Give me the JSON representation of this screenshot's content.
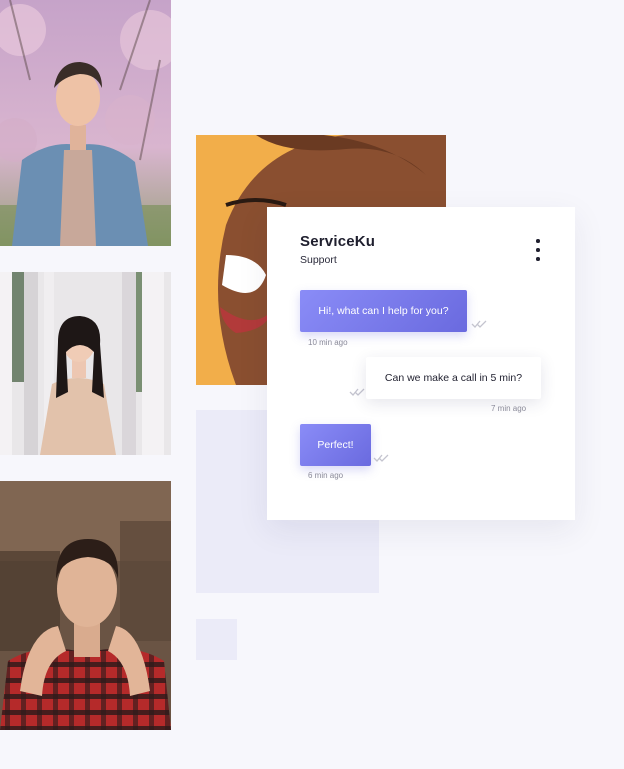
{
  "chat": {
    "title": "ServiceKu",
    "subtitle": "Support",
    "messages": [
      {
        "direction": "outgoing",
        "text": "Hi!, what can I help for you?",
        "time": "10 min ago"
      },
      {
        "direction": "incoming",
        "text": "Can we make a call in 5 min?",
        "time": "7 min ago"
      },
      {
        "direction": "outgoing",
        "text": "Perfect!",
        "time": "6 min ago"
      }
    ]
  },
  "icons": {
    "menu": "more-vertical-icon",
    "read_receipt": "double-check-icon"
  },
  "colors": {
    "background": "#f7f7fc",
    "accent": "#7677ea",
    "accent_light": "#8a8cf7",
    "card": "#ffffff",
    "deco_square": "#ebebf8",
    "text_dark": "#1f1f2e",
    "text_muted": "#8a8a99"
  }
}
